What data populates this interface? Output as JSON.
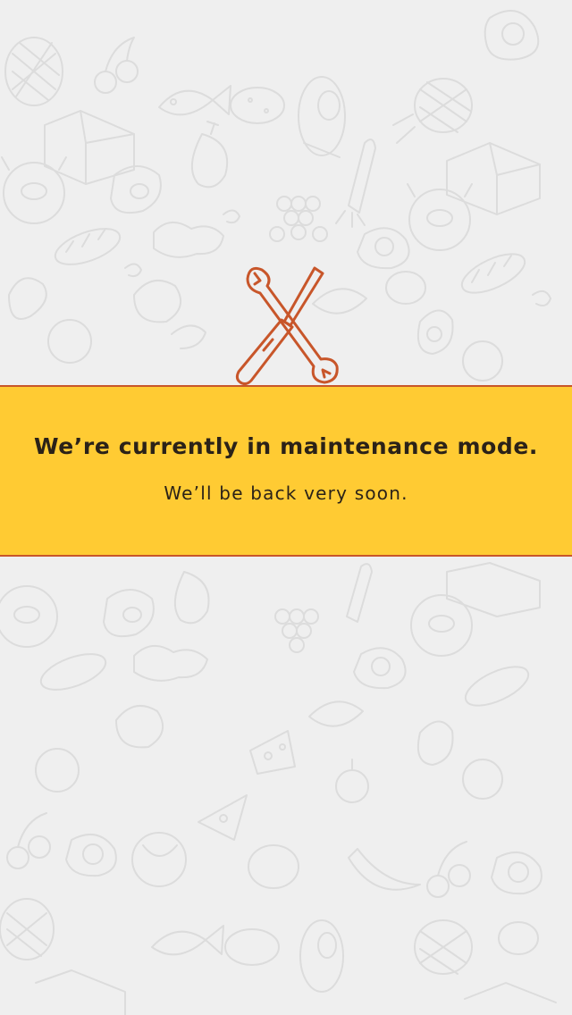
{
  "screen": {
    "background_color": "#efefef",
    "pattern_color": "#dcdcdc",
    "pattern_theme": "food-doodles"
  },
  "maintenance": {
    "icon": "wrench-screwdriver-icon",
    "icon_color": "#c8562a",
    "banner_color": "#ffcb33",
    "border_color": "#c8562a",
    "title": "We’re currently in maintenance mode.",
    "subtitle": "We’ll be back very soon."
  }
}
